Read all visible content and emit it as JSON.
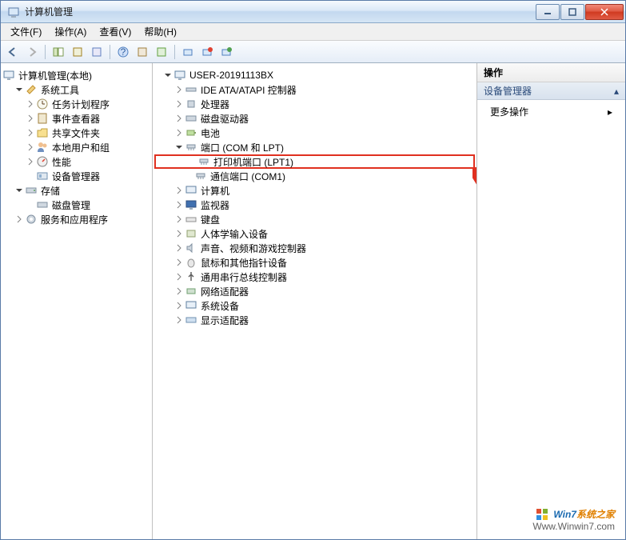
{
  "window": {
    "title": "计算机管理"
  },
  "menu": {
    "file": "文件(F)",
    "action": "操作(A)",
    "view": "查看(V)",
    "help": "帮助(H)"
  },
  "left_tree": {
    "root": "计算机管理(本地)",
    "system_tools": "系统工具",
    "task_scheduler": "任务计划程序",
    "event_viewer": "事件查看器",
    "shared_folders": "共享文件夹",
    "local_users": "本地用户和组",
    "performance": "性能",
    "device_manager": "设备管理器",
    "storage": "存储",
    "disk_management": "磁盘管理",
    "services_apps": "服务和应用程序"
  },
  "device_tree": {
    "root": "USER-20191113BX",
    "ide": "IDE ATA/ATAPI 控制器",
    "cpu": "处理器",
    "disk": "磁盘驱动器",
    "battery": "电池",
    "ports": "端口 (COM 和 LPT)",
    "printer_port": "打印机端口 (LPT1)",
    "com_port": "通信端口 (COM1)",
    "computer": "计算机",
    "monitor": "监视器",
    "keyboard": "键盘",
    "hid": "人体学输入设备",
    "sound": "声音、视频和游戏控制器",
    "mouse": "鼠标和其他指针设备",
    "usb": "通用串行总线控制器",
    "network": "网络适配器",
    "system_devices": "系统设备",
    "display": "显示适配器"
  },
  "actions": {
    "header": "操作",
    "section": "设备管理器",
    "more": "更多操作"
  },
  "watermark": {
    "brand1": "Win7",
    "brand2": "系统之家",
    "url": "Www.Winwin7.com"
  }
}
